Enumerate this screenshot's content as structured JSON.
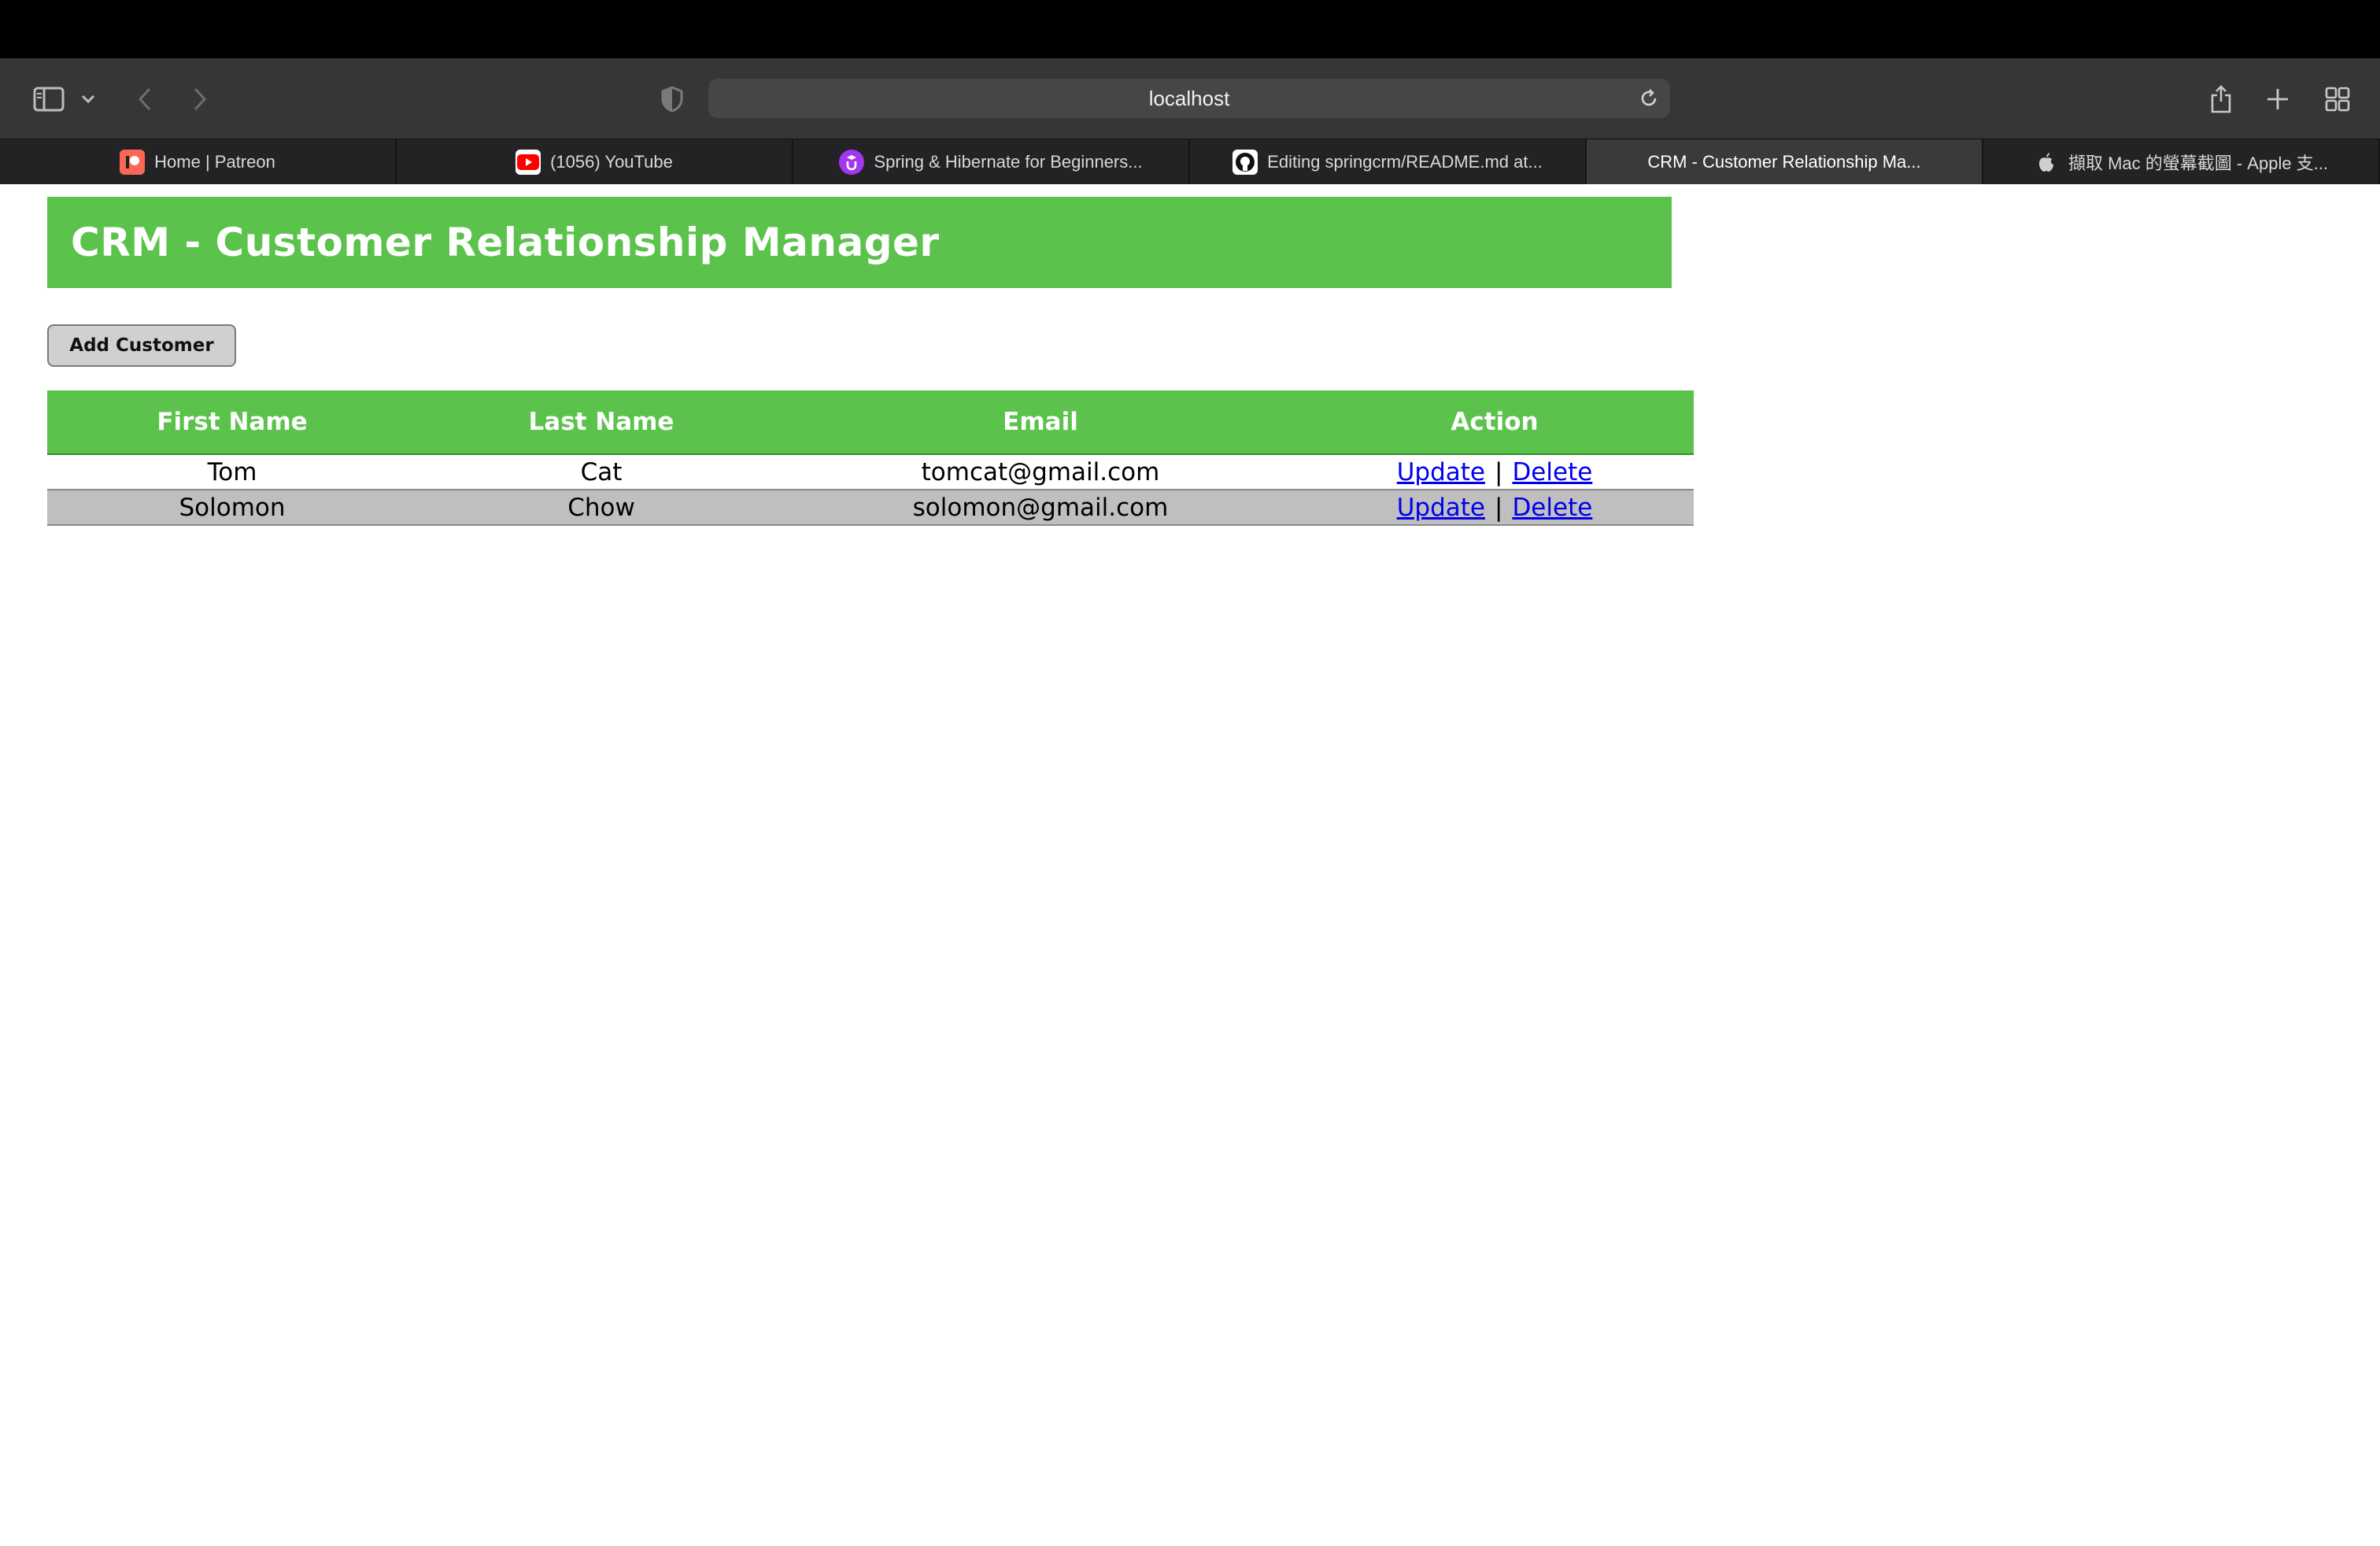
{
  "browser": {
    "url": "localhost",
    "tabs": [
      {
        "title": "Home | Patreon",
        "icon": "patreon-icon",
        "active": false
      },
      {
        "title": "(1056) YouTube",
        "icon": "youtube-icon",
        "active": false
      },
      {
        "title": "Spring & Hibernate for Beginners...",
        "icon": "udemy-icon",
        "active": false
      },
      {
        "title": "Editing springcrm/README.md at...",
        "icon": "github-icon",
        "active": false
      },
      {
        "title": "CRM - Customer Relationship Ma...",
        "icon": "",
        "active": true
      },
      {
        "title": "擷取 Mac 的螢幕截圖 - Apple 支...",
        "icon": "apple-icon",
        "active": false
      }
    ]
  },
  "page": {
    "title": "CRM - Customer Relationship Manager",
    "add_button_label": "Add Customer",
    "table": {
      "columns": [
        "First Name",
        "Last Name",
        "Email",
        "Action"
      ],
      "rows": [
        {
          "first_name": "Tom",
          "last_name": "Cat",
          "email": "tomcat@gmail.com",
          "update_label": "Update",
          "separator": "|",
          "delete_label": "Delete"
        },
        {
          "first_name": "Solomon",
          "last_name": "Chow",
          "email": "solomon@gmail.com",
          "update_label": "Update",
          "separator": "|",
          "delete_label": "Delete"
        }
      ]
    }
  },
  "colors": {
    "header_green": "#5bc24c",
    "link_blue": "#0000ee",
    "alt_row_gray": "#bfbfbf"
  }
}
